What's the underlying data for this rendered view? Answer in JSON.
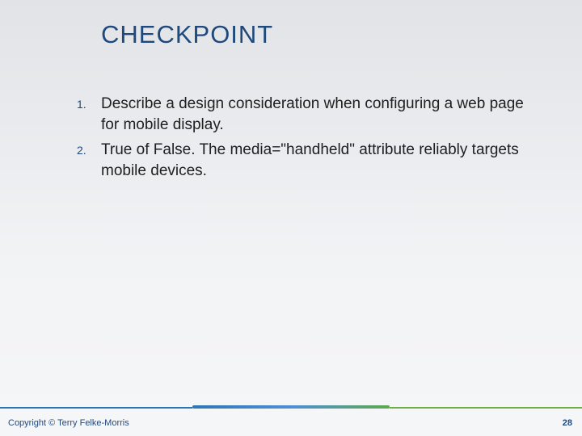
{
  "title": "CHECKPOINT",
  "items": [
    {
      "num": "1.",
      "text": "Describe a design consideration when configuring a web page for mobile display."
    },
    {
      "num": "2.",
      "text": "True of False. The media=\"handheld\" attribute reliably targets mobile devices."
    }
  ],
  "copyright": "Copyright © Terry Felke-Morris",
  "page_number": "28"
}
